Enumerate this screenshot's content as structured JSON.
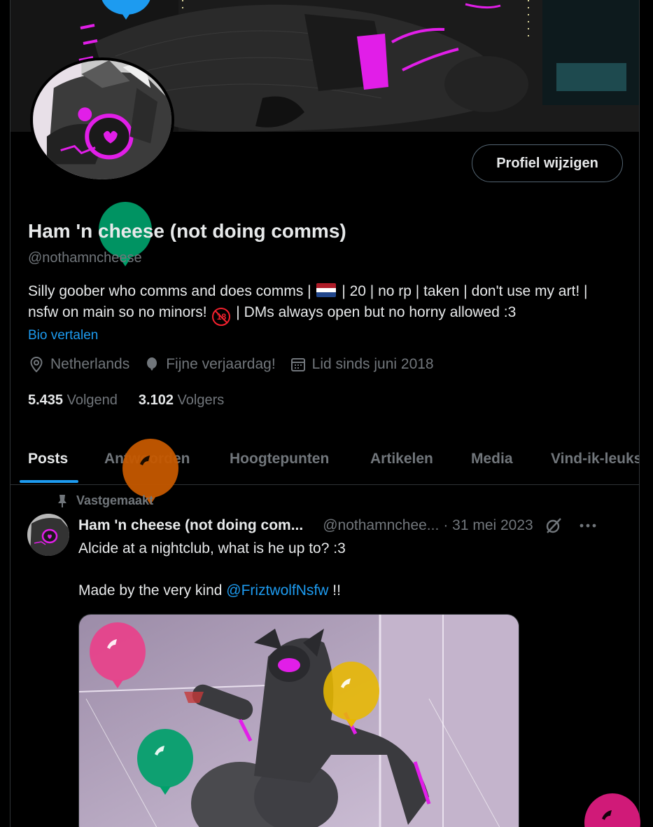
{
  "profile": {
    "display_name": "Ham 'n cheese (not doing comms)",
    "handle": "@nothamncheese",
    "edit_button": "Profiel wijzigen",
    "bio_part1": "Silly goober who comms and does comms |",
    "bio_part2": "| 20 | no rp | taken | don't use my art! | nsfw on main so no minors!",
    "bio_age_badge": "18",
    "bio_part3": "| DMs always open but no horny allowed :3",
    "translate_link": "Bio vertalen",
    "location": "Netherlands",
    "birthday": "Fijne verjaardag!",
    "joined": "Lid sinds juni 2018",
    "following_count": "5.435",
    "following_label": "Volgend",
    "followers_count": "3.102",
    "followers_label": "Volgers"
  },
  "tabs": [
    {
      "label": "Posts",
      "active": true
    },
    {
      "label": "Antwoorden",
      "active": false
    },
    {
      "label": "Hoogtepunten",
      "active": false
    },
    {
      "label": "Artikelen",
      "active": false
    },
    {
      "label": "Media",
      "active": false
    },
    {
      "label": "Vind-ik-leuks",
      "active": false
    }
  ],
  "post": {
    "pinned_label": "Vastgemaakt",
    "author_name": "Ham 'n cheese (not doing com...",
    "author_handle": "@nothamnchee...",
    "date": "· 31 mei 2023",
    "text_line1": "Alcide at a nightclub, what is he up to? :3",
    "text_line2_prefix": "Made by the very kind",
    "text_mention": "@FriztwolfNsfw",
    "text_line2_suffix": "!!"
  },
  "colors": {
    "accent": "#1d9bf0",
    "neon_pink": "#e11ee8",
    "muted_text": "#71767b",
    "balloon_blue": "#1d9bf0",
    "balloon_green": "#00a06a",
    "balloon_orange": "#c55800",
    "balloon_pink": "#e8418a",
    "balloon_yellow": "#e8b800",
    "balloon_magenta": "#d01a78"
  },
  "icons": [
    "location-icon",
    "balloon-icon",
    "calendar-icon",
    "pin-icon",
    "grok-icon",
    "more-icon"
  ]
}
